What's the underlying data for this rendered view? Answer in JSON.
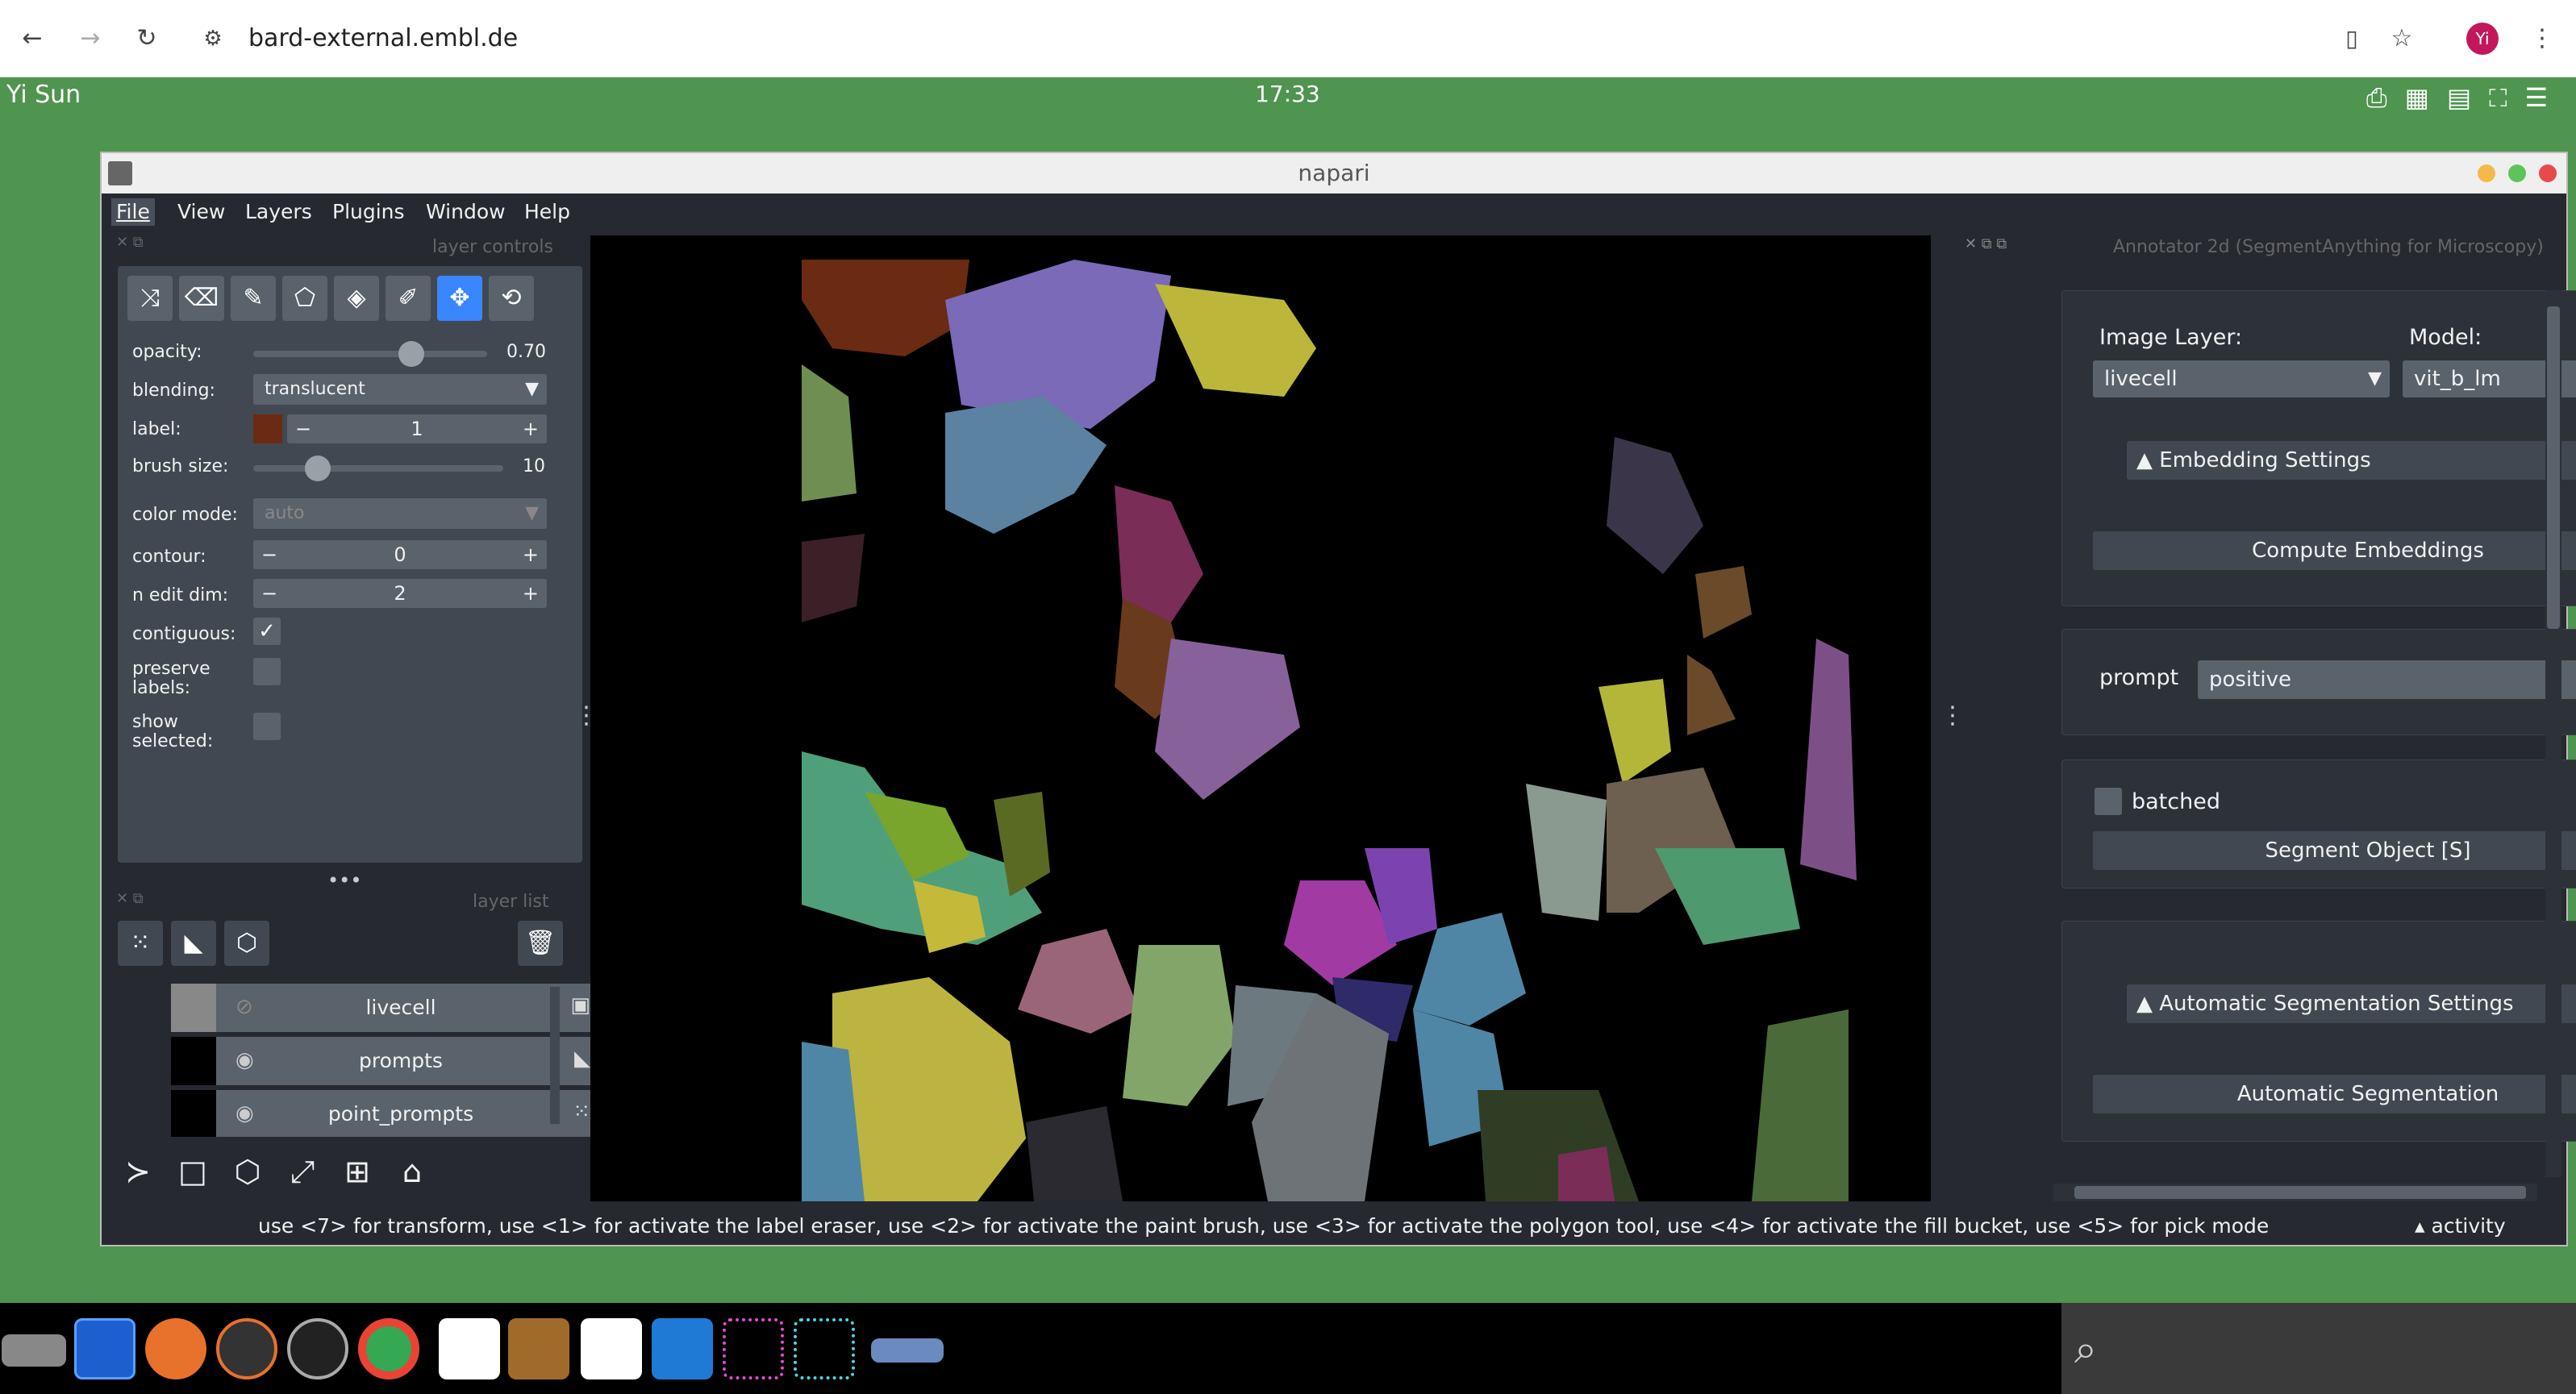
{
  "browser": {
    "url": "bard-external.embl.de",
    "profile_initial": "Yi"
  },
  "desktop": {
    "user": "Yi Sun",
    "clock": "17:33"
  },
  "window": {
    "title": "napari",
    "menu": [
      "File",
      "View",
      "Layers",
      "Plugins",
      "Window",
      "Help"
    ]
  },
  "layer_controls": {
    "header": "layer controls",
    "opacity_label": "opacity:",
    "opacity_value": "0.70",
    "opacity_fraction": 0.7,
    "blending_label": "blending:",
    "blending_value": "translucent",
    "label_label": "label:",
    "label_value": "1",
    "label_color": "#6b2a12",
    "brush_size_label": "brush size:",
    "brush_size_value": "10",
    "color_mode_label": "color mode:",
    "color_mode_value": "auto",
    "contour_label": "contour:",
    "contour_value": "0",
    "n_edit_dim_label": "n edit dim:",
    "n_edit_dim_value": "2",
    "contiguous_label": "contiguous:",
    "contiguous_checked": true,
    "preserve_labels_label": "preserve labels:",
    "show_selected_label": "show selected:"
  },
  "layer_list": {
    "header": "layer list",
    "layers": [
      {
        "name": "livecell",
        "visible": false
      },
      {
        "name": "prompts",
        "visible": true
      },
      {
        "name": "point_prompts",
        "visible": true
      }
    ]
  },
  "annotator": {
    "title": "Annotator 2d (SegmentAnything for Microscopy)",
    "image_layer_label": "Image Layer:",
    "image_layer_value": "livecell",
    "model_label": "Model:",
    "model_value": "vit_b_lm",
    "embedding_settings": "Embedding Settings",
    "compute_embeddings": "Compute Embeddings",
    "prompt_label": "prompt",
    "prompt_value": "positive",
    "batched_label": "batched",
    "segment_object": "Segment Object [S]",
    "auto_settings": "Automatic Segmentation Settings",
    "auto_segmentation": "Automatic Segmentation"
  },
  "status": {
    "message": "use <7> for transform, use <1> for activate the label eraser, use <2> for activate the paint brush, use <3> for activate the polygon tool, use <4> for activate the fill bucket, use <5> for pick mode",
    "activity": "activity"
  },
  "colors": {
    "desktop_green": "#4f944f",
    "napari_bg": "#262930",
    "panel": "#414851",
    "accent_blue": "#3a86ff"
  }
}
